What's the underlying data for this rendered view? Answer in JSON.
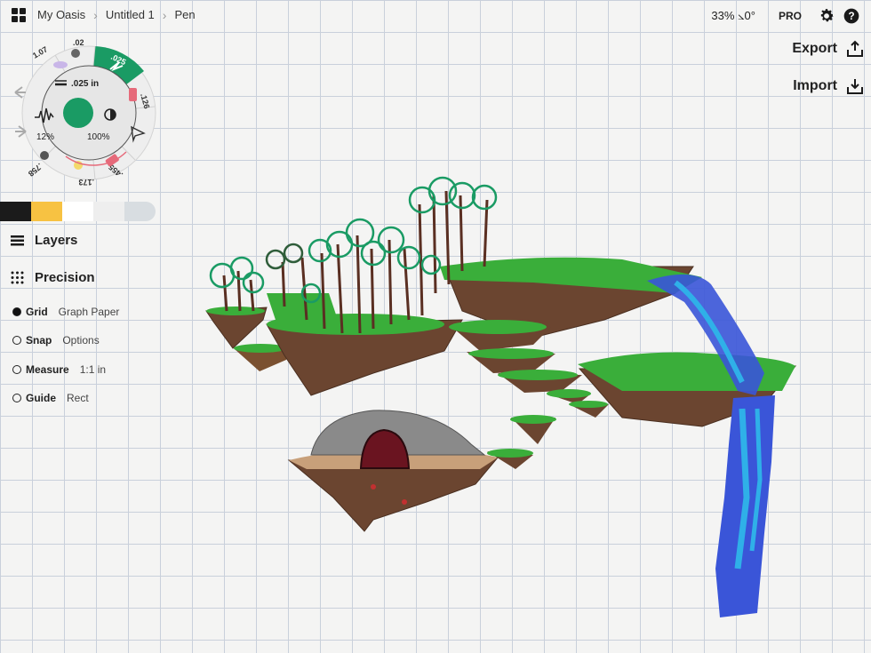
{
  "topbar": {
    "breadcrumbs": [
      "My Oasis",
      "Untitled 1",
      "Pen"
    ],
    "zoom": "33%",
    "angle": "⦣0°",
    "pro_label": "PRO"
  },
  "actions": {
    "export_label": "Export",
    "import_label": "Import"
  },
  "tool_wheel": {
    "size_top_left": "1.07",
    "size_top": ".02",
    "size_active": ".025",
    "size_right": ".126",
    "size_bottom_right": ".455",
    "size_bottom": ".173",
    "size_bottom_left": ".758",
    "stroke_width": ".025 in",
    "smoothing": "12%",
    "opacity": "100%",
    "current_color": "#1a9b64"
  },
  "swatches": [
    "#1b1b1b",
    "#f7c242",
    "#ffffff",
    "#eeeeee",
    "#d8dde1"
  ],
  "panels": {
    "layers_label": "Layers",
    "precision_label": "Precision"
  },
  "precision_options": [
    {
      "label": "Grid",
      "value": "Graph Paper",
      "active": true
    },
    {
      "label": "Snap",
      "value": "Options",
      "active": false
    },
    {
      "label": "Measure",
      "value": "1:1 in",
      "active": false
    },
    {
      "label": "Guide",
      "value": "Rect",
      "active": false
    }
  ],
  "colors": {
    "accent": "#1a9b64",
    "grass": "#3aae3a",
    "soil": "#6b4530",
    "water": "#3a55d8"
  }
}
